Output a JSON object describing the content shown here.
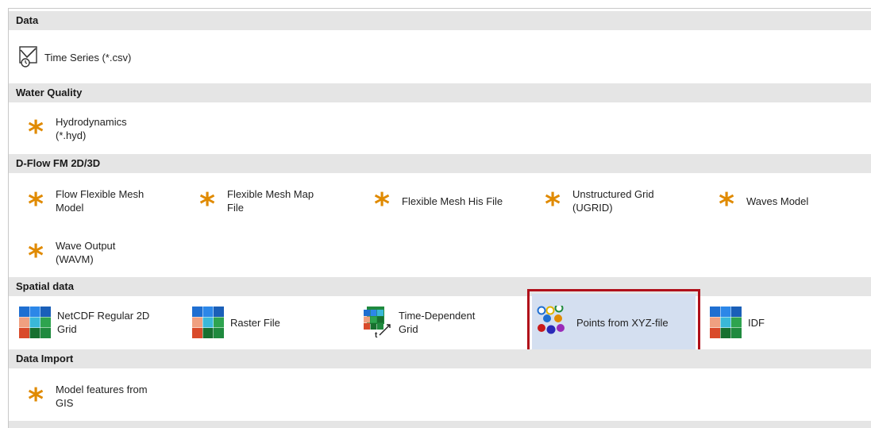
{
  "sections": [
    {
      "title": "Data",
      "items": [
        {
          "label": "Time Series (*.csv)",
          "icon": "time-series-icon"
        }
      ]
    },
    {
      "title": "Water Quality",
      "items": [
        {
          "label": "Hydrodynamics\n(*.hyd)",
          "icon": "asterisk-icon"
        }
      ]
    },
    {
      "title": "D-Flow FM 2D/3D",
      "items": [
        {
          "label": "Flow Flexible Mesh\nModel",
          "icon": "asterisk-icon"
        },
        {
          "label": "Flexible Mesh Map\nFile",
          "icon": "asterisk-icon"
        },
        {
          "label": "Flexible Mesh His File",
          "icon": "asterisk-icon"
        },
        {
          "label": "Unstructured Grid\n(UGRID)",
          "icon": "asterisk-icon"
        },
        {
          "label": "Waves Model",
          "icon": "asterisk-icon"
        },
        {
          "label": "Wave Output\n(WAVM)",
          "icon": "asterisk-icon"
        }
      ]
    },
    {
      "title": "Spatial data",
      "items": [
        {
          "label": "NetCDF Regular 2D\nGrid",
          "icon": "grid-icon"
        },
        {
          "label": "Raster File",
          "icon": "grid-icon"
        },
        {
          "label": "Time-Dependent\nGrid",
          "icon": "time-grid-icon"
        },
        {
          "label": "Points from XYZ-file",
          "icon": "points-icon",
          "selected": true
        },
        {
          "label": "IDF",
          "icon": "grid-icon"
        }
      ]
    },
    {
      "title": "Data Import",
      "items": [
        {
          "label": "Model features from\nGIS",
          "icon": "asterisk-icon"
        }
      ]
    }
  ],
  "colors": {
    "header_bg": "#e5e5e5",
    "asterisk": "#e08a00",
    "selection_bg": "#d4dff0",
    "selection_border": "#b0101a"
  }
}
